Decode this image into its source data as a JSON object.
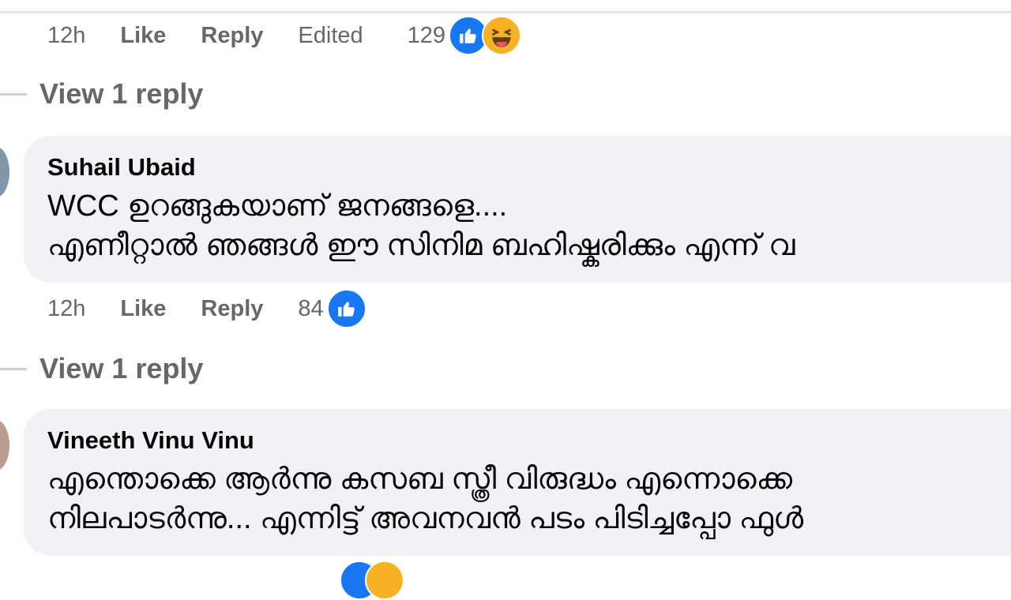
{
  "comment0": {
    "time": "12h",
    "like": "Like",
    "reply": "Reply",
    "edited": "Edited",
    "count": "129",
    "reactions": [
      "like-icon",
      "haha-icon"
    ]
  },
  "view_reply_1": "View 1 reply",
  "comment1": {
    "author": "Suhail Ubaid",
    "line1": "WCC ഉറങ്ങുകയാണ് ജനങ്ങളെ....",
    "line2": "എണീറ്റാൽ ഞങ്ങൾ ഈ സിനിമ ബഹിഷ്കരിക്കും എന്ന് വ",
    "time": "12h",
    "like": "Like",
    "reply": "Reply",
    "count": "84",
    "reactions": [
      "like-icon"
    ]
  },
  "view_reply_2": "View 1 reply",
  "comment2": {
    "author": "Vineeth Vinu Vinu",
    "line1": "എന്തൊക്കെ ആർന്നു കസബ സ്ത്രീ വിരുദ്ധം എന്നൊക്കെ",
    "line2": "നിലപാടർന്നു... എന്നിട്ട് അവനവൻ പടം പിടിച്ചപ്പോ ഫുൾ",
    "reactions": [
      "like-icon",
      "haha-icon"
    ]
  },
  "colors": {
    "bubble": "#f0f2f5",
    "meta_text": "#65676b",
    "like_blue": "#1877f2",
    "haha_yellow": "#f7b125"
  }
}
